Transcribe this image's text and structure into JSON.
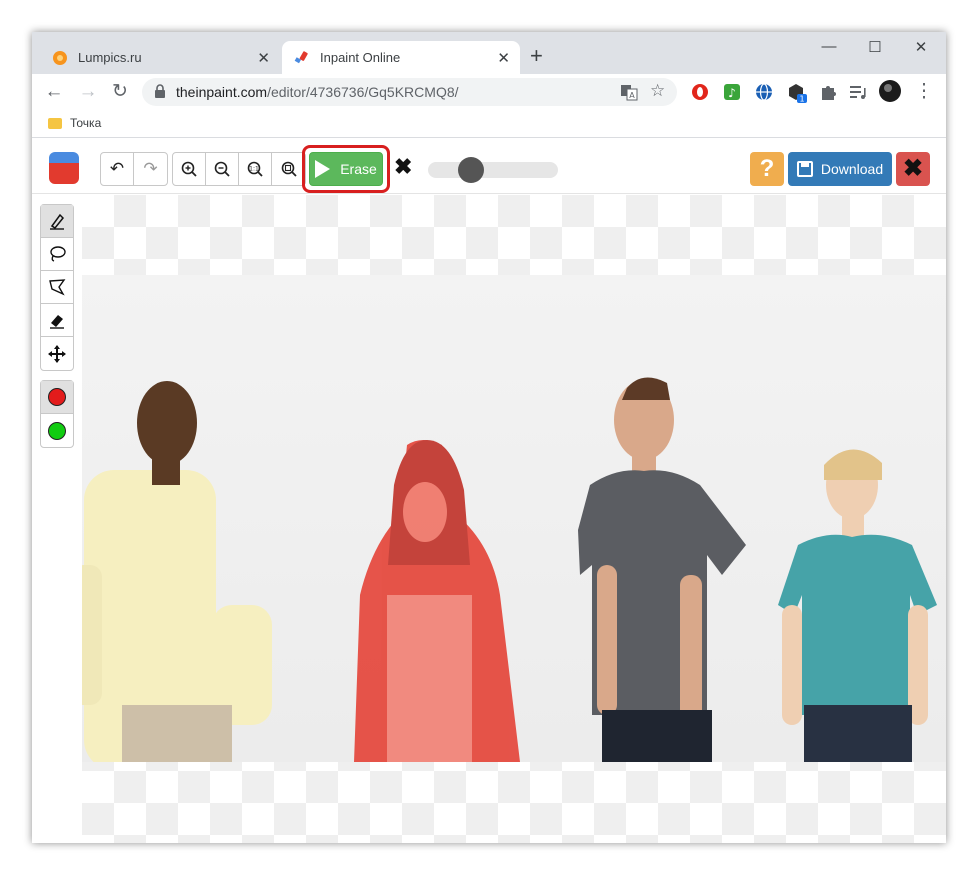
{
  "browser": {
    "tabs": [
      {
        "title": "Lumpics.ru",
        "favicon": "orange-circle-icon",
        "active": false
      },
      {
        "title": "Inpaint Online",
        "favicon": "brush-icon",
        "active": true
      }
    ],
    "url_host": "theinpaint.com",
    "url_path": "/editor/4736736/Gq5KRCMQ8/",
    "bookmark": "Точка",
    "extension_badge": "1"
  },
  "app": {
    "erase_label": "Erase",
    "help_label": "?",
    "download_label": "Download",
    "brush_size": 0.32,
    "marker_colors": {
      "remove": "#e31b1b",
      "keep": "#11cc11"
    },
    "accent_colors": {
      "erase": "#5cb85c",
      "download": "#337ab7",
      "help": "#f0ad4e",
      "close": "#d9534f",
      "highlight": "#d81f1f"
    }
  }
}
